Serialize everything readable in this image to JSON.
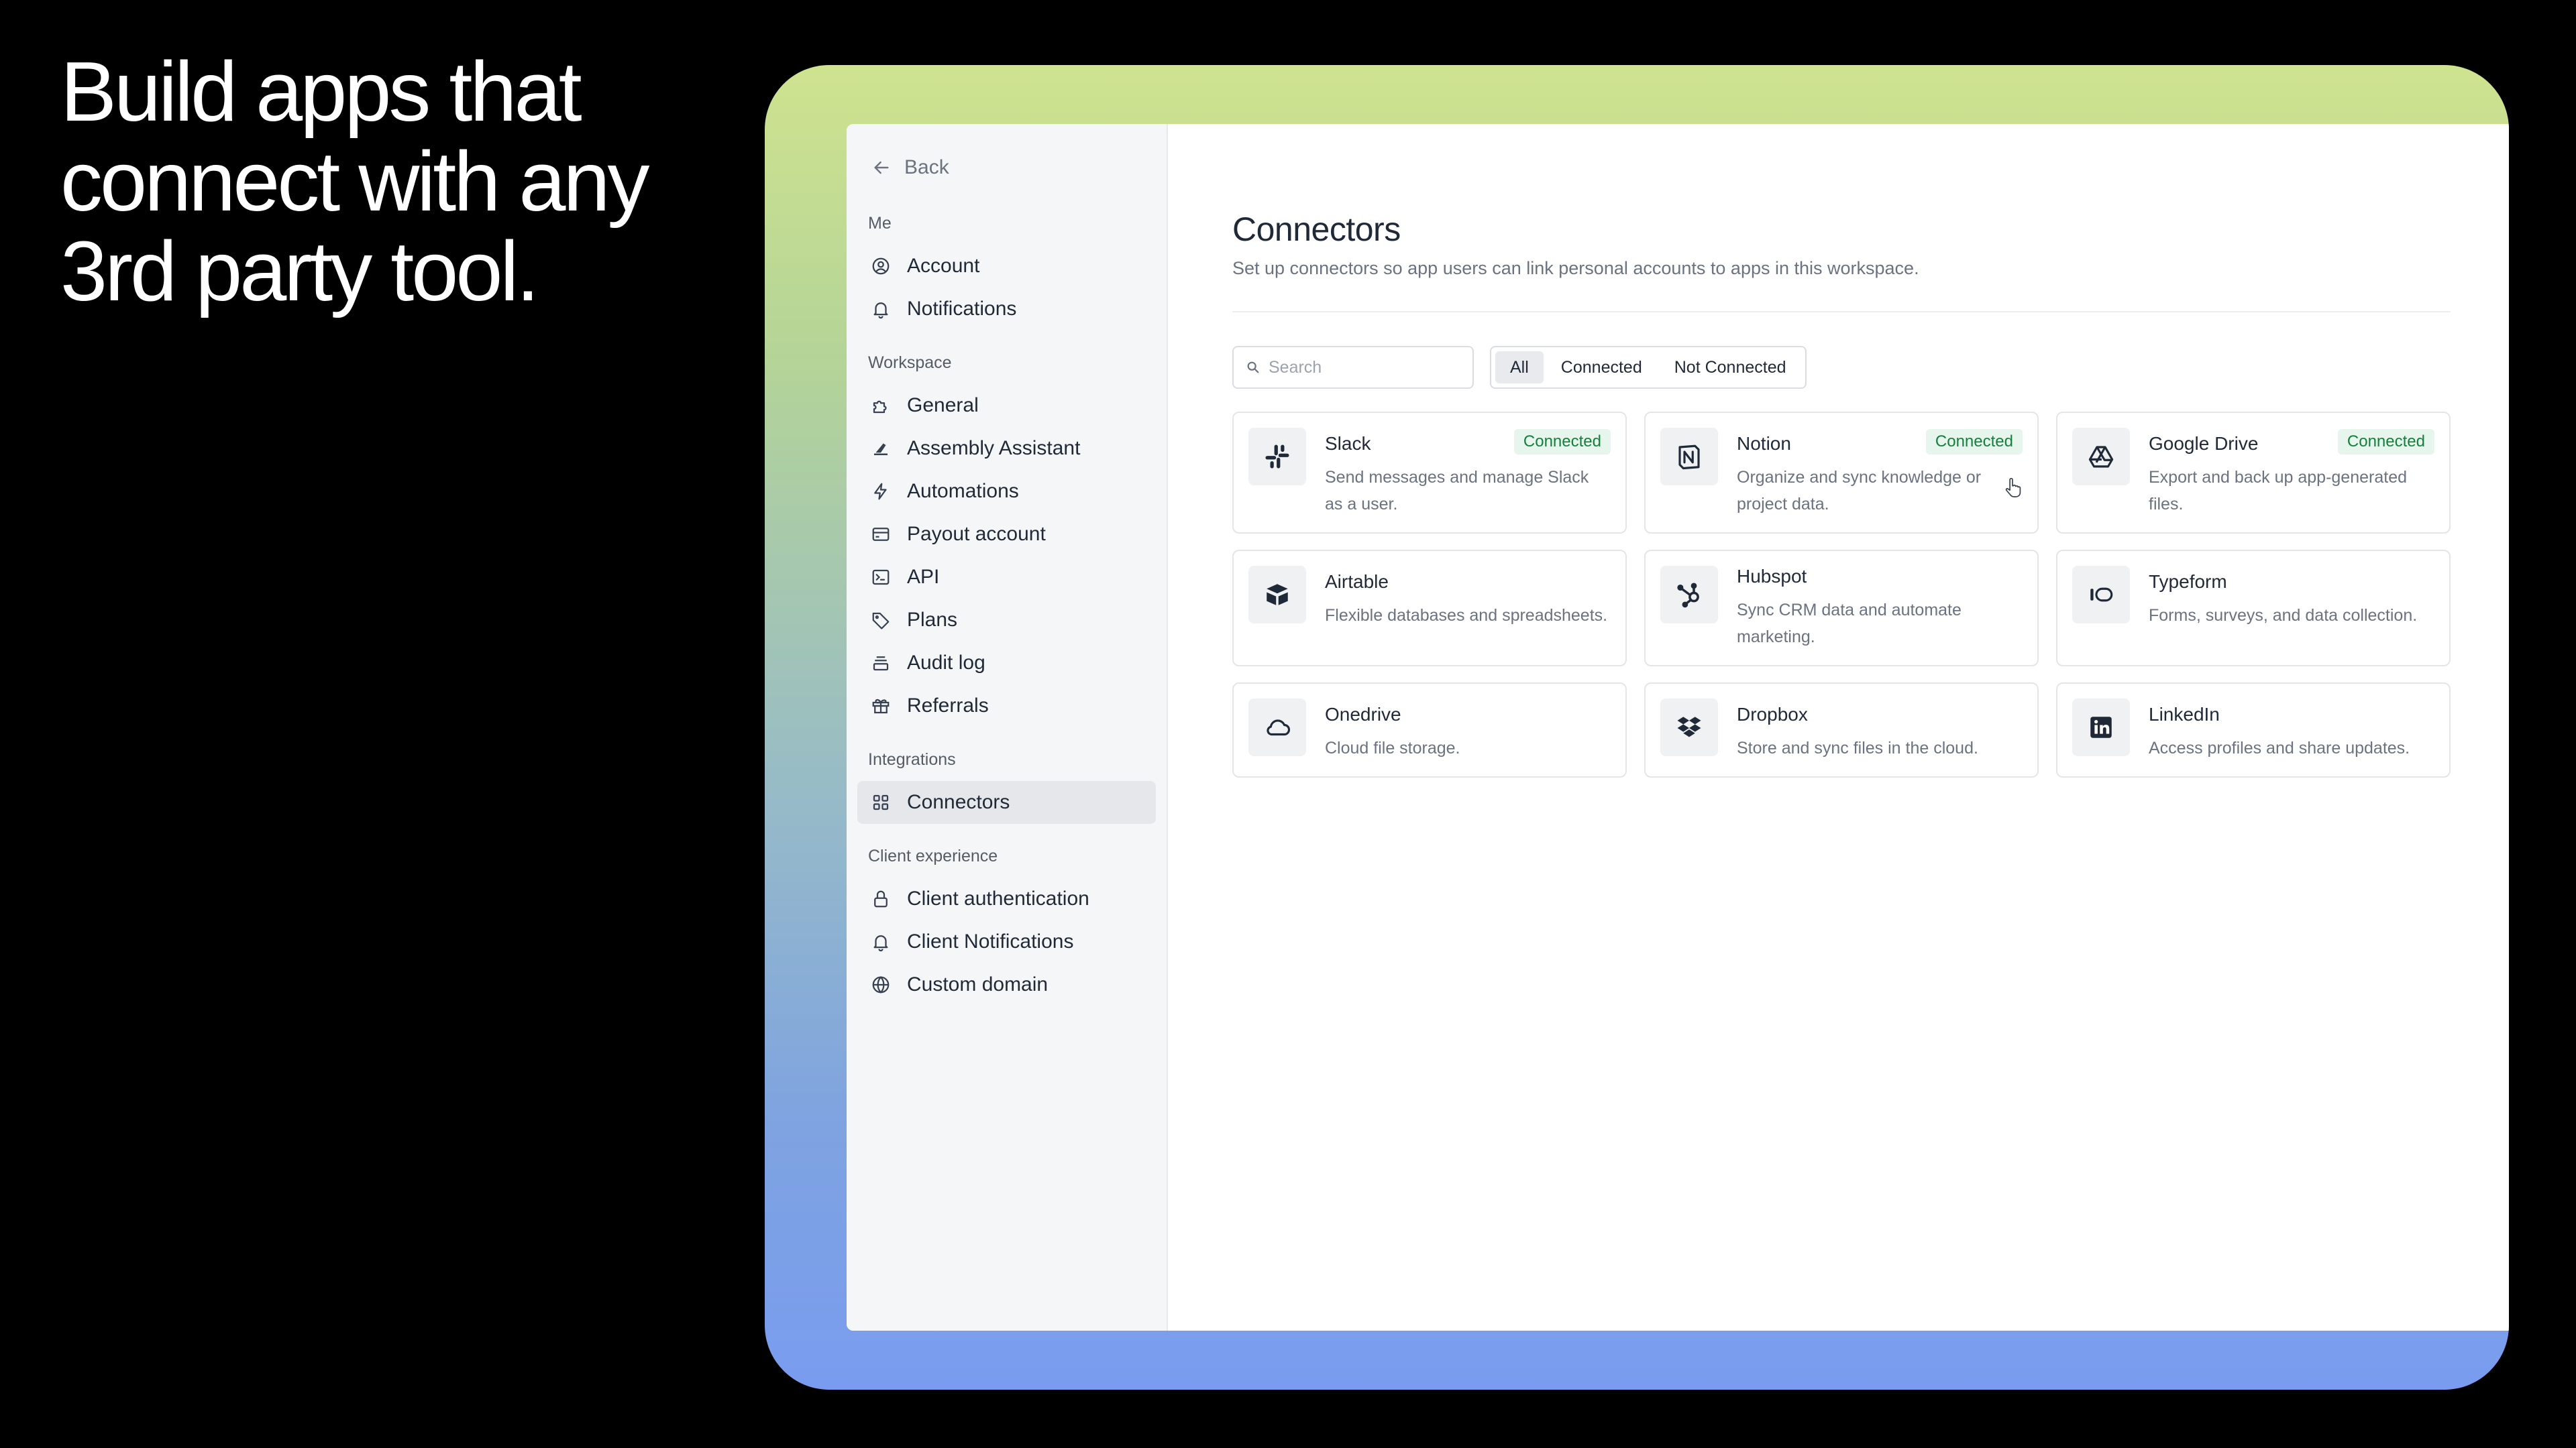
{
  "headline": [
    "Build apps that",
    "connect with any",
    "3rd party tool."
  ],
  "sidebar": {
    "back_label": "Back",
    "sections": [
      {
        "label": "Me",
        "items": [
          {
            "label": "Account",
            "icon": "user-circle-icon"
          },
          {
            "label": "Notifications",
            "icon": "bell-icon"
          }
        ]
      },
      {
        "label": "Workspace",
        "items": [
          {
            "label": "General",
            "icon": "puzzle-icon"
          },
          {
            "label": "Assembly Assistant",
            "icon": "assistant-icon"
          },
          {
            "label": "Automations",
            "icon": "lightning-icon"
          },
          {
            "label": "Payout account",
            "icon": "credit-card-icon"
          },
          {
            "label": "API",
            "icon": "terminal-icon"
          },
          {
            "label": "Plans",
            "icon": "tag-icon"
          },
          {
            "label": "Audit log",
            "icon": "stack-icon"
          },
          {
            "label": "Referrals",
            "icon": "gift-icon"
          }
        ]
      },
      {
        "label": "Integrations",
        "items": [
          {
            "label": "Connectors",
            "icon": "grid-icon",
            "active": true
          }
        ]
      },
      {
        "label": "Client experience",
        "items": [
          {
            "label": "Client authentication",
            "icon": "lock-icon"
          },
          {
            "label": "Client Notifications",
            "icon": "bell-icon"
          },
          {
            "label": "Custom domain",
            "icon": "globe-icon"
          }
        ]
      }
    ]
  },
  "main": {
    "title": "Connectors",
    "subtitle": "Set up connectors so app users can link personal accounts to apps in this workspace.",
    "search": {
      "placeholder": "Search",
      "value": ""
    },
    "filters": [
      {
        "label": "All",
        "active": true
      },
      {
        "label": "Connected",
        "active": false
      },
      {
        "label": "Not Connected",
        "active": false
      }
    ],
    "connectors": [
      {
        "name": "Slack",
        "description": "Send messages and manage Slack as a user.",
        "status": "Connected",
        "icon": "slack-icon"
      },
      {
        "name": "Notion",
        "description": "Organize and sync knowledge or project data.",
        "status": "Connected",
        "icon": "notion-icon"
      },
      {
        "name": "Google Drive",
        "description": "Export and back up app-generated files.",
        "status": "Connected",
        "icon": "google-drive-icon"
      },
      {
        "name": "Airtable",
        "description": "Flexible databases and spreadsheets.",
        "status": "",
        "icon": "airtable-icon"
      },
      {
        "name": "Hubspot",
        "description": "Sync CRM data and automate marketing.",
        "status": "",
        "icon": "hubspot-icon"
      },
      {
        "name": "Typeform",
        "description": "Forms, surveys, and data collection.",
        "status": "",
        "icon": "typeform-icon"
      },
      {
        "name": "Onedrive",
        "description": "Cloud file storage.",
        "status": "",
        "icon": "cloud-icon"
      },
      {
        "name": "Dropbox",
        "description": "Store and sync files in the cloud.",
        "status": "",
        "icon": "dropbox-icon"
      },
      {
        "name": "LinkedIn",
        "description": "Access profiles and share updates.",
        "status": "",
        "icon": "linkedin-icon"
      }
    ]
  },
  "colors": {
    "background": "#000000",
    "badge_bg": "#e6f6ec",
    "badge_text": "#15803d",
    "gradient_top": "#cfe38f",
    "gradient_bottom": "#7a9cf0"
  }
}
